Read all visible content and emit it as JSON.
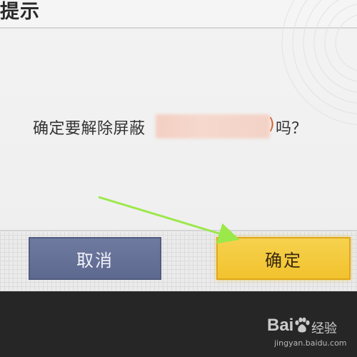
{
  "dialog": {
    "title": "提示",
    "message_prefix": "确定要解除屏蔽",
    "message_paren_close": ")",
    "message_suffix": "吗？"
  },
  "buttons": {
    "cancel_label": "取消",
    "confirm_label": "确定"
  },
  "colors": {
    "cancel_button": "#6a759a",
    "confirm_button": "#f4c93c",
    "arrow": "#9be84a",
    "redacted_name": "#d96030"
  },
  "watermark": {
    "logo": "Bai",
    "brand_suffix": "经验",
    "url": "jingyan.baidu.com"
  }
}
